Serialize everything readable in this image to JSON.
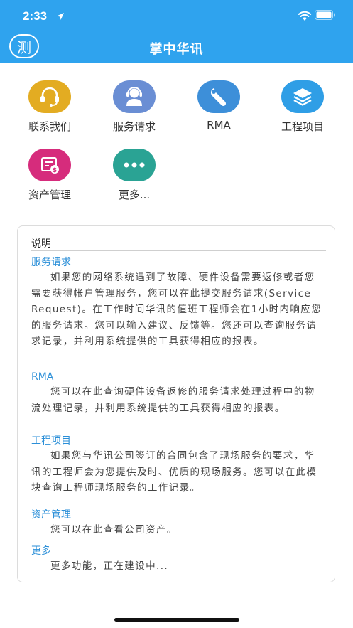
{
  "status_bar": {
    "time": "2:33"
  },
  "nav": {
    "test_button": "测",
    "title": "掌中华讯"
  },
  "menu": [
    {
      "label": "联系我们",
      "icon": "headset-icon",
      "color": "#e3ac22"
    },
    {
      "label": "服务请求",
      "icon": "support-agent-icon",
      "color": "#6a8ed4"
    },
    {
      "label": "RMA",
      "icon": "wrench-icon",
      "color": "#3d8fd9"
    },
    {
      "label": "工程项目",
      "icon": "layers-icon",
      "color": "#2f9ee6"
    },
    {
      "label": "资产管理",
      "icon": "asset-card-icon",
      "color": "#d62c7c"
    },
    {
      "label": "更多...",
      "icon": "more-dots-icon",
      "color": "#2aa394"
    }
  ],
  "panel": {
    "title": "说明",
    "sections": [
      {
        "title": "服务请求",
        "body": "如果您的网络系统遇到了故障、硬件设备需要返修或者您需要获得帐户管理服务，您可以在此提交服务请求(Service Request)。在工作时间华讯的值班工程师会在1小时内响应您的服务请求。您可以输入建议、反馈等。您还可以查询服务请求记录，并利用系统提供的工具获得相应的报表。"
      },
      {
        "title": "RMA",
        "body": "您可以在此查询硬件设备返修的服务请求处理过程中的物流处理记录，并利用系统提供的工具获得相应的报表。"
      },
      {
        "title": "工程项目",
        "body": "如果您与华讯公司签订的合同包含了现场服务的要求，华讯的工程师会为您提供及时、优质的现场服务。您可以在此模块查询工程师现场服务的工作记录。"
      },
      {
        "title": "资产管理",
        "body": "您可以在此查看公司资产。"
      },
      {
        "title": "更多",
        "body": "更多功能，正在建设中..."
      }
    ]
  }
}
